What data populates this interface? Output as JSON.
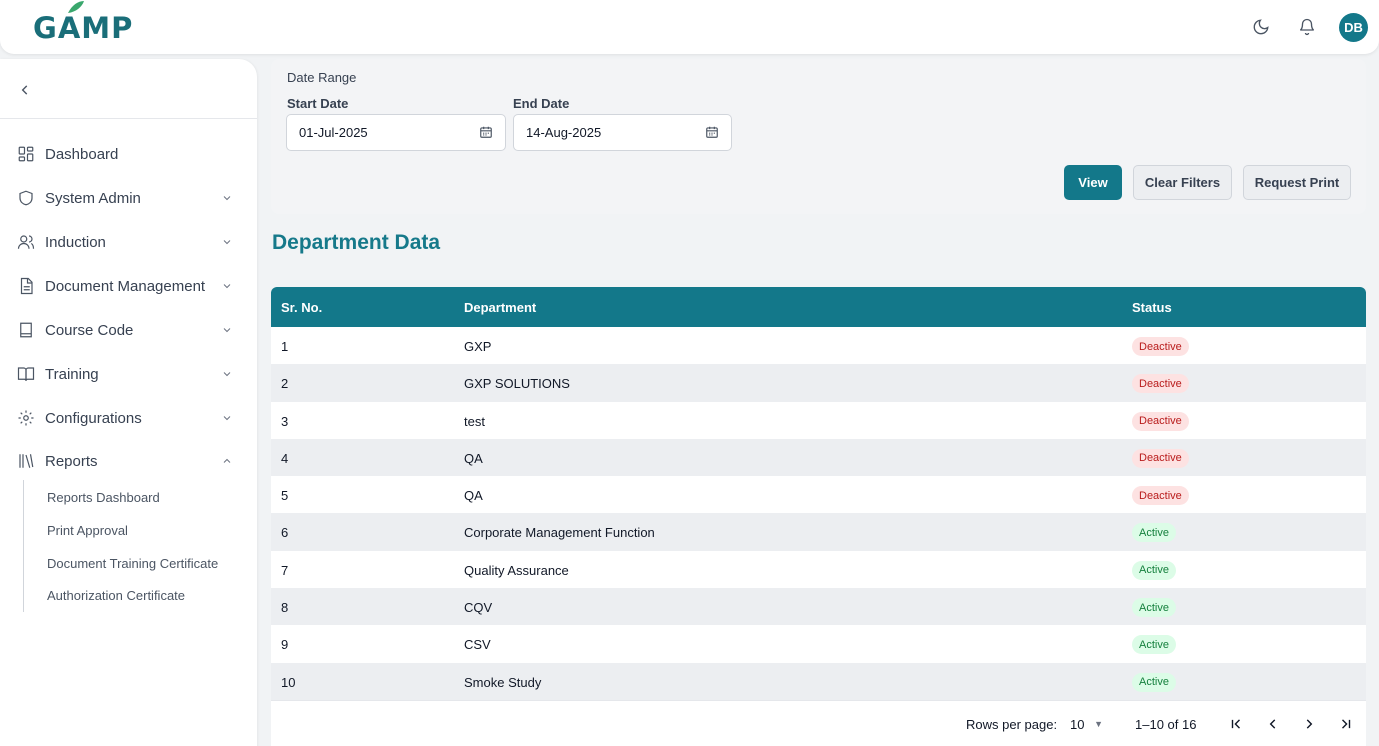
{
  "header": {
    "logo_text": "GAMP",
    "user_initials": "DB",
    "brand_color": "#13788a"
  },
  "sidebar": {
    "items": [
      {
        "label": "Dashboard",
        "icon": "dashboard-grid-icon"
      },
      {
        "label": "System Admin",
        "icon": "shield-icon"
      },
      {
        "label": "Induction",
        "icon": "users-icon"
      },
      {
        "label": "Document Management",
        "icon": "document-icon"
      },
      {
        "label": "Course Code",
        "icon": "book-icon"
      },
      {
        "label": "Training",
        "icon": "open-book-icon"
      },
      {
        "label": "Configurations",
        "icon": "gear-icon"
      },
      {
        "label": "Reports",
        "icon": "library-icon",
        "expanded": true
      }
    ],
    "report_sub_items": [
      "Reports Dashboard",
      "Print Approval",
      "Document Training Certificate",
      "Authorization Certificate"
    ]
  },
  "filters": {
    "date_range_label": "Date Range",
    "start_date_label": "Start Date",
    "start_date_value": "01-Jul-2025",
    "end_date_label": "End Date",
    "end_date_value": "14-Aug-2025",
    "view_label": "View",
    "clear_label": "Clear Filters",
    "print_label": "Request Print"
  },
  "section_title": "Department Data",
  "table": {
    "columns": [
      "Sr. No.",
      "Department",
      "Status"
    ],
    "rows": [
      {
        "sr": "1",
        "department": "GXP",
        "status": "Deactive"
      },
      {
        "sr": "2",
        "department": "GXP SOLUTIONS",
        "status": "Deactive"
      },
      {
        "sr": "3",
        "department": "test",
        "status": "Deactive"
      },
      {
        "sr": "4",
        "department": "QA",
        "status": "Deactive"
      },
      {
        "sr": "5",
        "department": "QA",
        "status": "Deactive"
      },
      {
        "sr": "6",
        "department": "Corporate Management Function",
        "status": "Active"
      },
      {
        "sr": "7",
        "department": "Quality Assurance",
        "status": "Active"
      },
      {
        "sr": "8",
        "department": "CQV",
        "status": "Active"
      },
      {
        "sr": "9",
        "department": "CSV",
        "status": "Active"
      },
      {
        "sr": "10",
        "department": "Smoke Study",
        "status": "Active"
      }
    ]
  },
  "pagination": {
    "rows_per_page_label": "Rows per page:",
    "rows_per_page_value": "10",
    "range_text": "1–10 of 16"
  }
}
